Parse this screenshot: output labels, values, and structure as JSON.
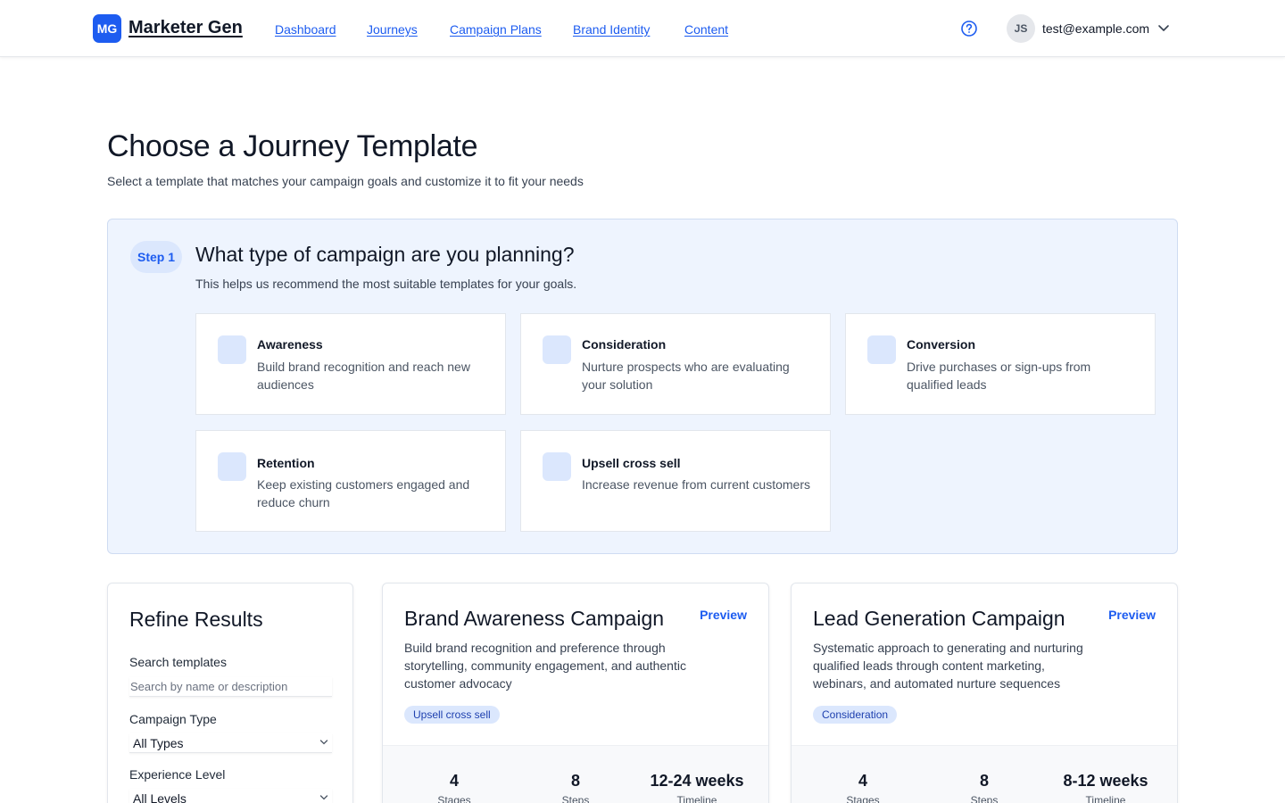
{
  "header": {
    "logo_initials": "MG",
    "app_name": "Marketer Gen",
    "nav": [
      "Dashboard",
      "Journeys",
      "Campaign Plans",
      "Brand Identity",
      "Content"
    ],
    "user_initials": "JS",
    "user_email": "test@example.com"
  },
  "page": {
    "title": "Choose a Journey Template",
    "subtitle": "Select a template that matches your campaign goals and customize it to fit your needs"
  },
  "step": {
    "badge": "Step 1",
    "heading": "What type of campaign are you planning?",
    "description": "This helps us recommend the most suitable templates for your goals.",
    "goals": [
      {
        "title": "Awareness",
        "description": "Build brand recognition and reach new audiences"
      },
      {
        "title": "Consideration",
        "description": "Nurture prospects who are evaluating your solution"
      },
      {
        "title": "Conversion",
        "description": "Drive purchases or sign-ups from qualified leads"
      },
      {
        "title": "Retention",
        "description": "Keep existing customers engaged and reduce churn"
      },
      {
        "title": "Upsell cross sell",
        "description": "Increase revenue from current customers"
      }
    ]
  },
  "filters": {
    "title": "Refine Results",
    "search_label": "Search templates",
    "search_placeholder": "Search by name or description",
    "type_label": "Campaign Type",
    "type_value": "All Types",
    "level_label": "Experience Level",
    "level_value": "All Levels"
  },
  "templates": [
    {
      "name": "Brand Awareness Campaign",
      "preview": "Preview",
      "description": "Build brand recognition and preference through storytelling, community engagement, and authentic customer advocacy",
      "tag": "Upsell cross sell",
      "stats": [
        {
          "value": "4",
          "label": "Stages"
        },
        {
          "value": "8",
          "label": "Steps"
        },
        {
          "value": "12-24 weeks",
          "label": "Timeline"
        }
      ]
    },
    {
      "name": "Lead Generation Campaign",
      "preview": "Preview",
      "description": "Systematic approach to generating and nurturing qualified leads through content marketing, webinars, and automated nurture sequences",
      "tag": "Consideration",
      "stats": [
        {
          "value": "4",
          "label": "Stages"
        },
        {
          "value": "8",
          "label": "Steps"
        },
        {
          "value": "8-12 weeks",
          "label": "Timeline"
        }
      ]
    }
  ]
}
